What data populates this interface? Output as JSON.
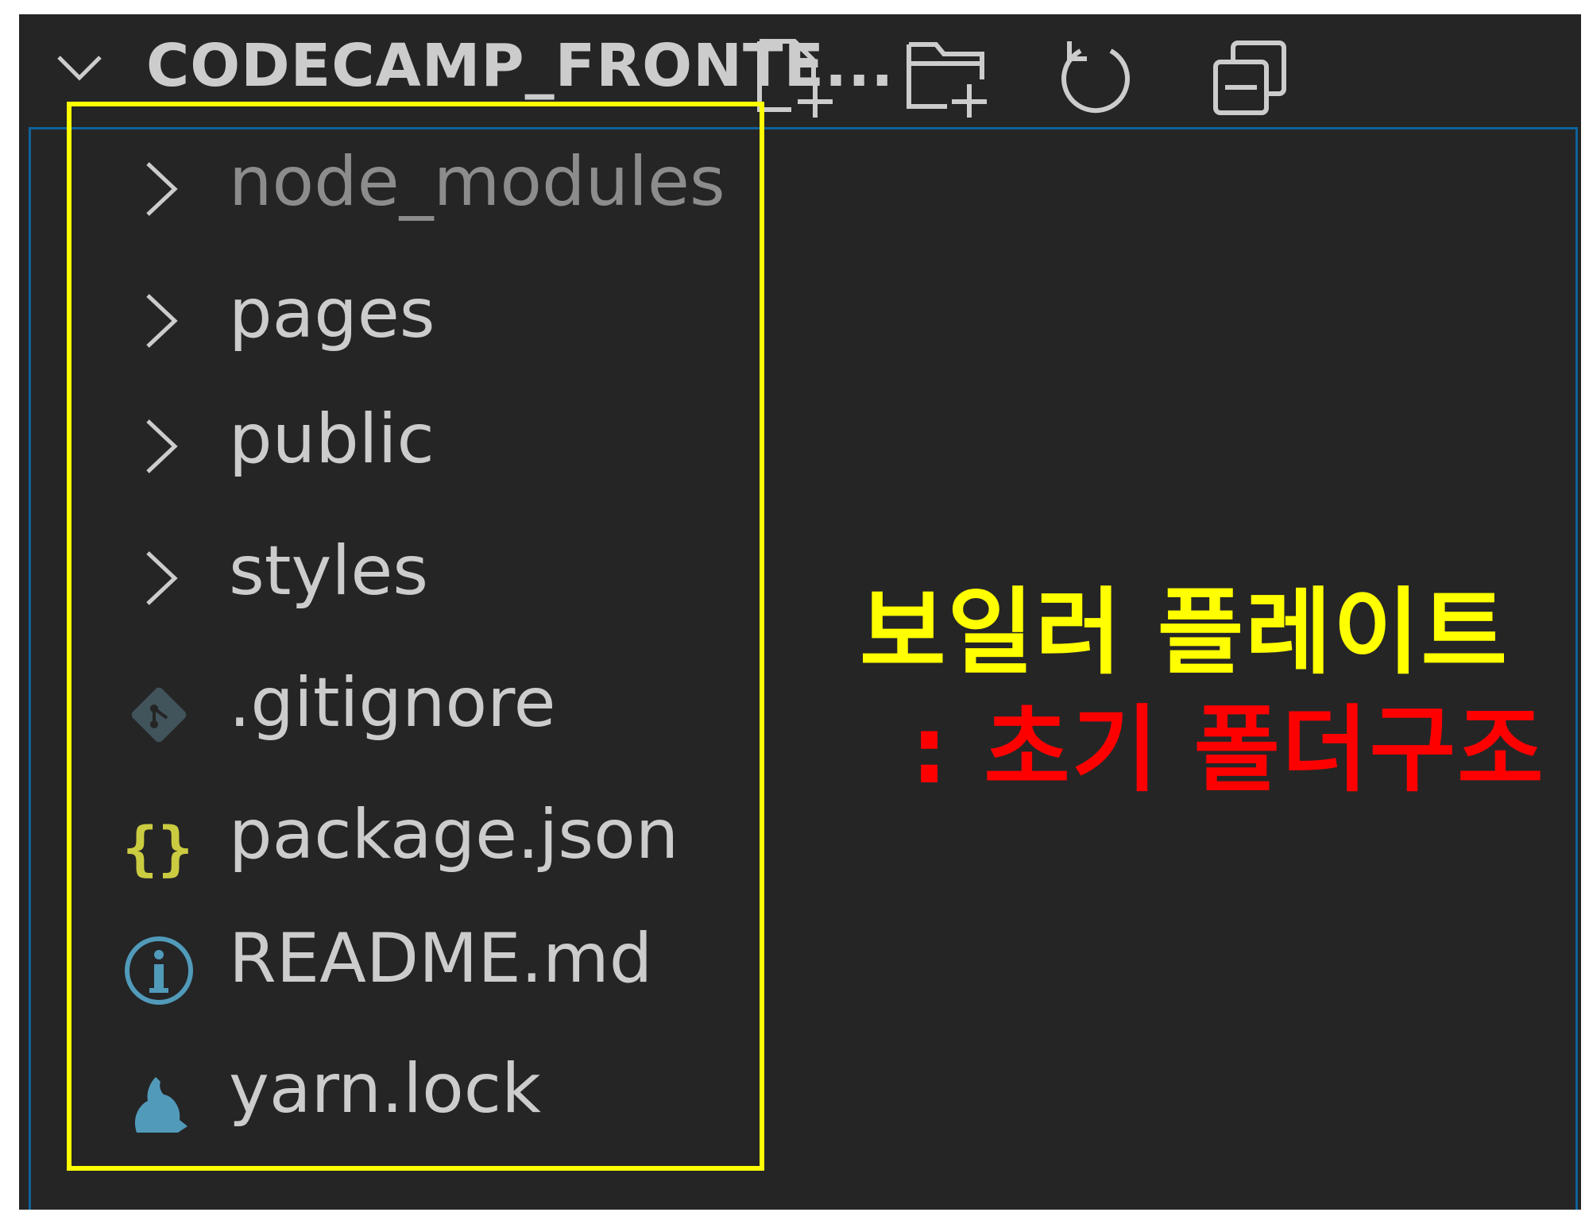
{
  "explorer": {
    "title": "CODECAMP_FRONTE...",
    "actions": [
      {
        "name": "new-file-icon"
      },
      {
        "name": "new-folder-icon"
      },
      {
        "name": "refresh-icon"
      },
      {
        "name": "collapse-all-icon"
      }
    ],
    "items": [
      {
        "label": "node_modules",
        "kind": "folder",
        "dim": true
      },
      {
        "label": "pages",
        "kind": "folder"
      },
      {
        "label": "public",
        "kind": "folder"
      },
      {
        "label": "styles",
        "kind": "folder"
      },
      {
        "label": ".gitignore",
        "kind": "file",
        "icon": "git-icon"
      },
      {
        "label": "package.json",
        "kind": "file",
        "icon": "json-braces-icon"
      },
      {
        "label": "README.md",
        "kind": "file",
        "icon": "info-icon"
      },
      {
        "label": "yarn.lock",
        "kind": "file",
        "icon": "yarn-icon"
      }
    ]
  },
  "annotation": {
    "title": "보일러 플레이트",
    "subtitle": ": 초기 폴더구조"
  },
  "colors": {
    "panel_bg": "#252526",
    "text": "#cccccc",
    "highlight": "#ffff00",
    "annotation_title": "#ffff00",
    "annotation_subtitle": "#ff0000",
    "focus_border": "#0e639c",
    "json_icon": "#cbcb41",
    "info_icon": "#519aba",
    "git_icon": "#41535b",
    "yarn_icon": "#519aba"
  }
}
